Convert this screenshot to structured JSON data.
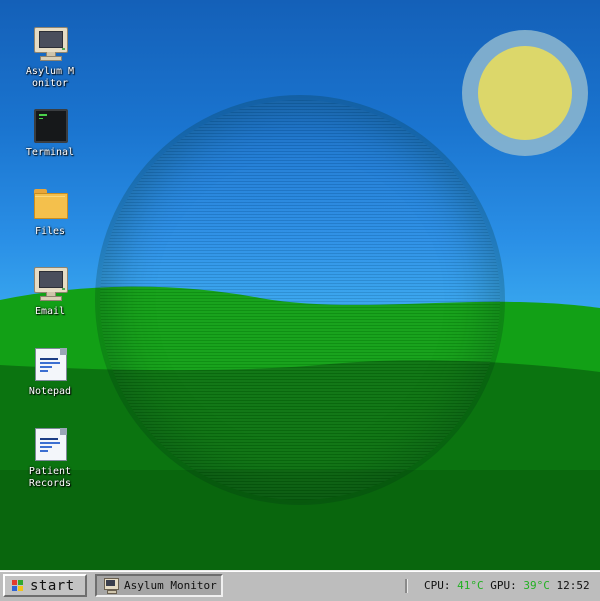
{
  "desktop": {
    "icons": [
      {
        "label": "Asylum Monitor",
        "icon": "monitor-icon"
      },
      {
        "label": "Terminal",
        "icon": "terminal-icon"
      },
      {
        "label": "Files",
        "icon": "folder-icon"
      },
      {
        "label": "Email",
        "icon": "monitor-icon"
      },
      {
        "label": "Notepad",
        "icon": "notepad-icon"
      },
      {
        "label": "Patient Records",
        "icon": "document-icon"
      }
    ]
  },
  "taskbar": {
    "start_label": "start",
    "active_window": {
      "label": "Asylum Monitor",
      "icon": "monitor-icon"
    },
    "tray": {
      "cpu_label": "CPU:",
      "cpu_value": "41°C",
      "gpu_label": "GPU:",
      "gpu_value": "39°C",
      "clock": "12:52"
    }
  },
  "colors": {
    "sky_top": "#1460b8",
    "sky_bottom": "#3fb0f2",
    "hill_front": "#0f8a14",
    "hill_back": "#0d6f10",
    "sun": "#dcd76a",
    "sun_halo": "#8fb8cf",
    "taskbar": "#bdbdbd",
    "temperature_ok": "#22b022"
  }
}
